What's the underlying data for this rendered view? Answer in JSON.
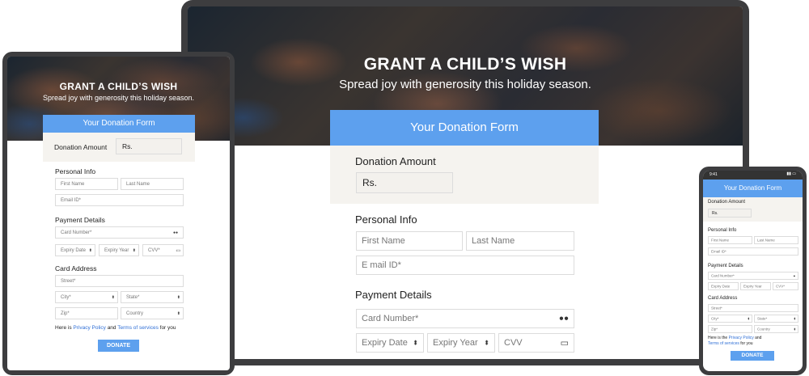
{
  "hero": {
    "title": "GRANT A CHILD’S WISH",
    "subtitle": "Spread joy with generosity this holiday season."
  },
  "form": {
    "header": "Your Donation Form",
    "amount_label": "Donation Amount",
    "amount_value": "Rs.",
    "personal_info_heading": "Personal Info",
    "first_name": "First Name",
    "last_name": "Last Name",
    "email": "Email ID*",
    "email_laptop": "E mail ID*",
    "payment_heading": "Payment Details",
    "card_number": "Card Number*",
    "expiry_date": "Expiry Date",
    "expiry_year": "Expiry Year",
    "cvv": "CVV*",
    "cvv_laptop": "CVV",
    "card_address_heading": "Card Address",
    "street": "Street*",
    "city": "City*",
    "state": "State*",
    "zip": "Zip*",
    "country": "Country",
    "privacy_prefix": "Here is the",
    "privacy_link": "Privacy Policy",
    "privacy_and": "and",
    "terms_link": "Terms of services",
    "privacy_suffix": "for you",
    "donate_button": "DONATE"
  },
  "phone": {
    "time": "9:41",
    "privacy_prefix": "Here is the"
  },
  "tablet": {
    "privacy_prefix": "Here is"
  },
  "icons": {
    "select": "updown-arrows-icon",
    "card": "card-chip-icon",
    "cvv": "cvv-card-icon"
  },
  "colors": {
    "accent": "#5da0ee",
    "link": "#2f6fd6",
    "amount_bg": "#f5f3ef"
  }
}
